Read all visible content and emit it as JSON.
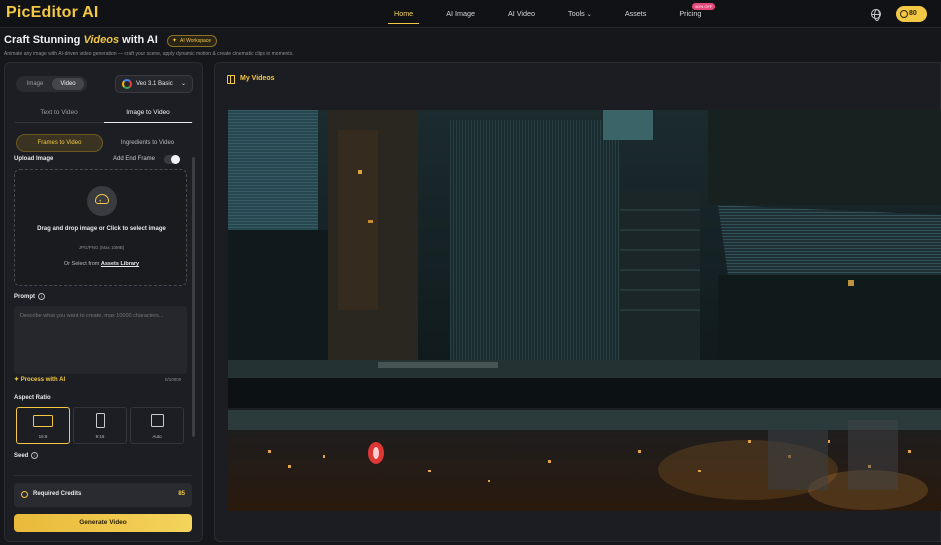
{
  "app": {
    "logo": "PicEditor AI"
  },
  "nav": {
    "items": [
      {
        "label": "Home",
        "active": true
      },
      {
        "label": "AI Image"
      },
      {
        "label": "AI Video"
      },
      {
        "label": "Tools",
        "dropdown": true
      },
      {
        "label": "Assets"
      },
      {
        "label": "Pricing",
        "badge": "50% OFF"
      }
    ],
    "credits": "80"
  },
  "hero": {
    "title_pre": "Craft Stunning ",
    "title_em": "Videos",
    "title_post": " with AI",
    "badge": "AI Workspace",
    "subtitle": "Animate any image with AI-driven video generation — craft your scene, apply dynamic motion & create cinematic clips in moments."
  },
  "left": {
    "mode": {
      "image": "Image",
      "video": "Video",
      "selected": "Video"
    },
    "model": "Veo 3.1 Basic",
    "tabs": [
      "Text to Video",
      "Image to Video"
    ],
    "active_tab": "Image to Video",
    "subtabs": [
      "Frames to Video",
      "Ingredients to Video"
    ],
    "active_subtab": "Frames to Video",
    "upload_label": "Upload Image",
    "end_frame_label": "Add End Frame",
    "upload": {
      "main": "Drag and drop image or Click to select image",
      "formats": "JPG/PNG (Max 10MB)",
      "or_text": "Or Select from ",
      "library_link": "Assets Library"
    },
    "prompt_label": "Prompt",
    "prompt_placeholder": "Describe what you want to create, max 10000 characters...",
    "process_label": "Process with AI",
    "char_count": "0/10000",
    "aspect_label": "Aspect Ratio",
    "ratios": [
      "16:9",
      "9:16",
      "Auto"
    ],
    "selected_ratio": "16:9",
    "seed_label": "Seed",
    "required_credits_label": "Required Credits",
    "required_credits_value": "85",
    "generate_label": "Generate Video"
  },
  "right": {
    "title": "My Videos"
  },
  "colors": {
    "accent": "#f3c845",
    "bg": "#16171b",
    "panel": "#1d1e23"
  }
}
